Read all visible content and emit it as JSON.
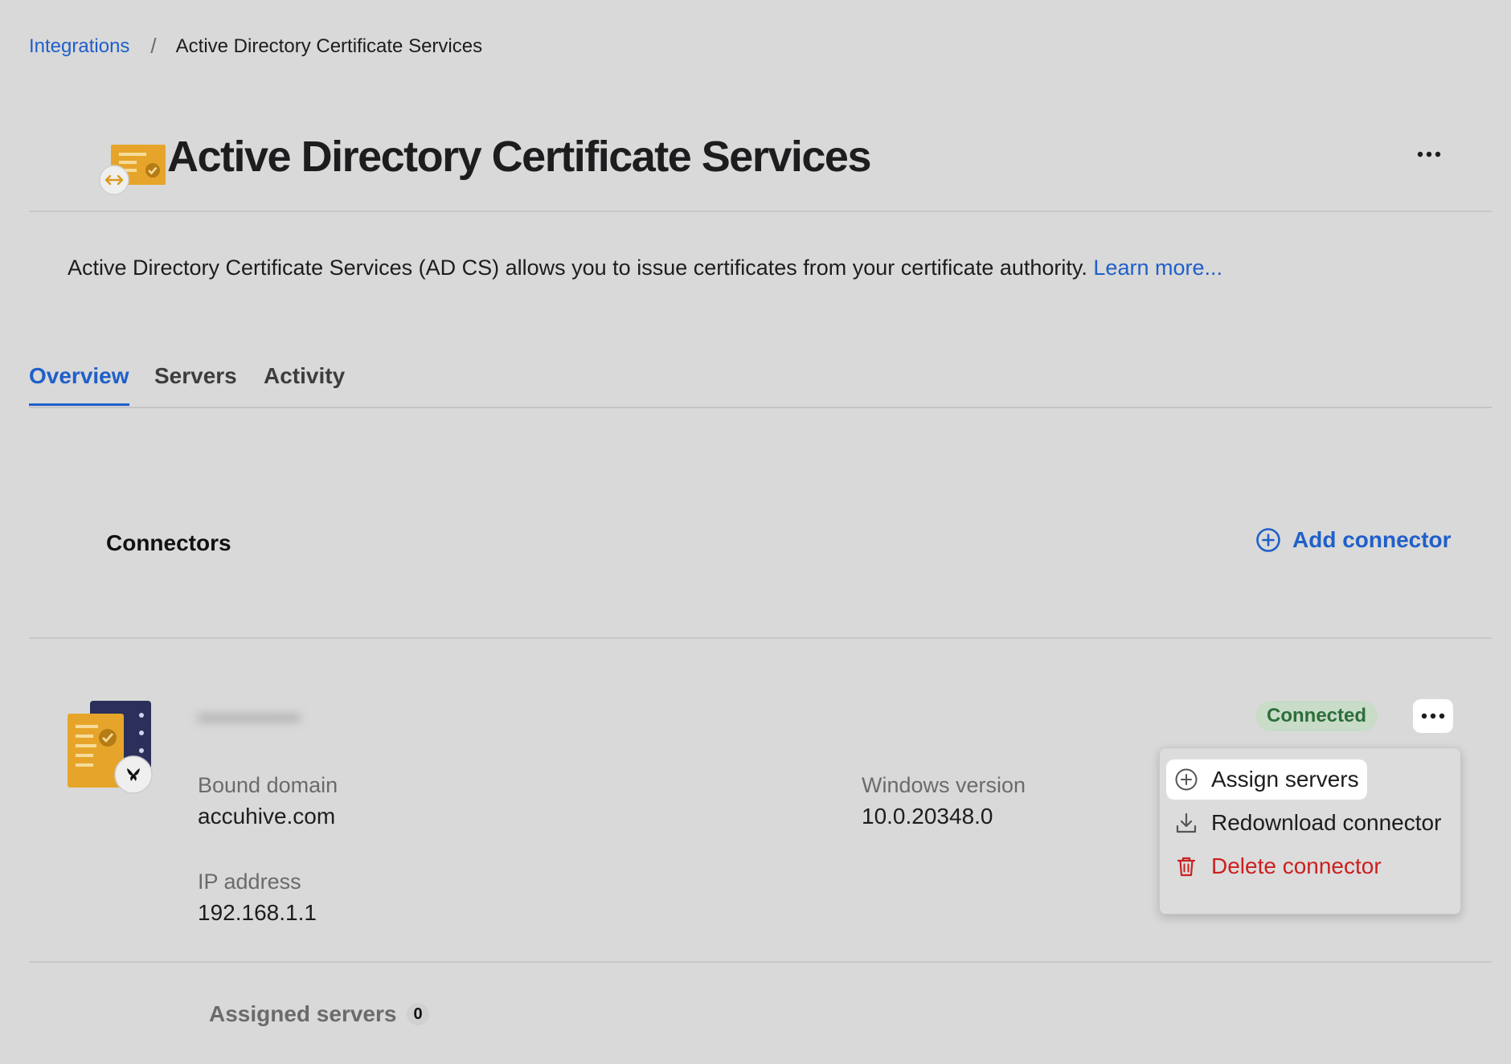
{
  "breadcrumb": {
    "parent_label": "Integrations",
    "separator": "/",
    "current_label": "Active Directory Certificate Services"
  },
  "header": {
    "title": "Active Directory Certificate Services",
    "logo_icon": "certificate-sync-icon",
    "more_icon": "ellipsis-icon"
  },
  "description": {
    "text": "Active Directory Certificate Services (AD CS) allows you to issue certificates from your certificate authority. ",
    "link_label": "Learn more..."
  },
  "tabs": [
    {
      "label": "Overview",
      "active": true
    },
    {
      "label": "Servers",
      "active": false
    },
    {
      "label": "Activity",
      "active": false
    }
  ],
  "connectors": {
    "title": "Connectors",
    "add_label": "Add connector",
    "add_icon": "plus-circle-icon"
  },
  "connector": {
    "name": "••••••••••••••",
    "icon": "certificate-server-icon",
    "status": "Connected",
    "fields": {
      "bound_domain_label": "Bound domain",
      "bound_domain_value": "accuhive.com",
      "windows_version_label": "Windows version",
      "windows_version_value": "10.0.20348.0",
      "ip_label": "IP address",
      "ip_value": "192.168.1.1"
    }
  },
  "menu": {
    "items": [
      {
        "label": "Assign servers",
        "icon": "plus-circle-icon"
      },
      {
        "label": "Redownload connector",
        "icon": "download-icon"
      },
      {
        "label": "Delete connector",
        "icon": "trash-icon"
      }
    ]
  },
  "assigned": {
    "label": "Assigned servers",
    "count": "0"
  },
  "colors": {
    "accent": "#1f5fc9",
    "danger": "#cc1f1f",
    "success": "#2c6e3a",
    "success_bg": "#c8dcc8",
    "background": "#d9d9d9",
    "brand_orange": "#e6a52a",
    "server_navy": "#2b2f5a"
  }
}
